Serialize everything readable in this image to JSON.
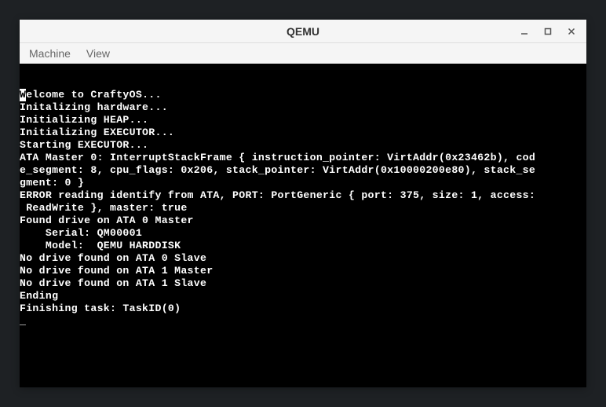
{
  "window": {
    "title": "QEMU"
  },
  "menubar": {
    "items": [
      "Machine",
      "View"
    ]
  },
  "terminal": {
    "lines": [
      "Welcome to CraftyOS...",
      "Initalizing hardware...",
      "Initializing HEAP...",
      "Initializing EXECUTOR...",
      "Starting EXECUTOR...",
      "ATA Master 0: InterruptStackFrame { instruction_pointer: VirtAddr(0x23462b), cod",
      "e_segment: 8, cpu_flags: 0x206, stack_pointer: VirtAddr(0x10000200e80), stack_se",
      "gment: 0 }",
      "ERROR reading identify from ATA, PORT: PortGeneric { port: 375, size: 1, access:",
      " ReadWrite }, master: true",
      "Found drive on ATA 0 Master",
      "    Serial: QM00001",
      "    Model:  QEMU HARDDISK",
      "No drive found on ATA 0 Slave",
      "No drive found on ATA 1 Master",
      "No drive found on ATA 1 Slave",
      "Ending",
      "Finishing task: TaskID(0)"
    ],
    "cursor_char": "_"
  }
}
